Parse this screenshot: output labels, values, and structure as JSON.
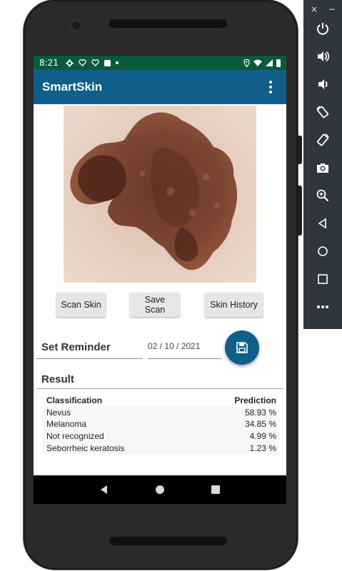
{
  "status_bar": {
    "time": "8:21"
  },
  "app_bar": {
    "title": "SmartSkin",
    "menu_icon": "more-vert-icon"
  },
  "buttons": {
    "scan": "Scan Skin",
    "save": "Save Scan",
    "history": "Skin History"
  },
  "reminder": {
    "label": "Set Reminder",
    "date": "02 / 10 / 2021",
    "save_icon": "floppy-disk-icon"
  },
  "result": {
    "title": "Result",
    "columns": [
      "Classification",
      "Prediction"
    ],
    "rows": [
      {
        "classification": "Nevus",
        "prediction": "58.93 %"
      },
      {
        "classification": "Melanoma",
        "prediction": "34.85 %"
      },
      {
        "classification": "Not recognized",
        "prediction": "4.99 %"
      },
      {
        "classification": "Seborrheic keratosis",
        "prediction": "1.23 %"
      }
    ]
  },
  "emulator_panel": {
    "close": "×",
    "minimize": "−",
    "icons": [
      "power-icon",
      "volume-up-icon",
      "volume-down-icon",
      "rotate-left-icon",
      "rotate-right-icon",
      "camera-icon",
      "zoom-icon",
      "back-icon",
      "home-icon",
      "overview-icon",
      "more-icon"
    ]
  },
  "colors": {
    "status_bar": "#0a5a3c",
    "app_bar": "#0f5f8a",
    "fab": "#0f5f8a"
  }
}
